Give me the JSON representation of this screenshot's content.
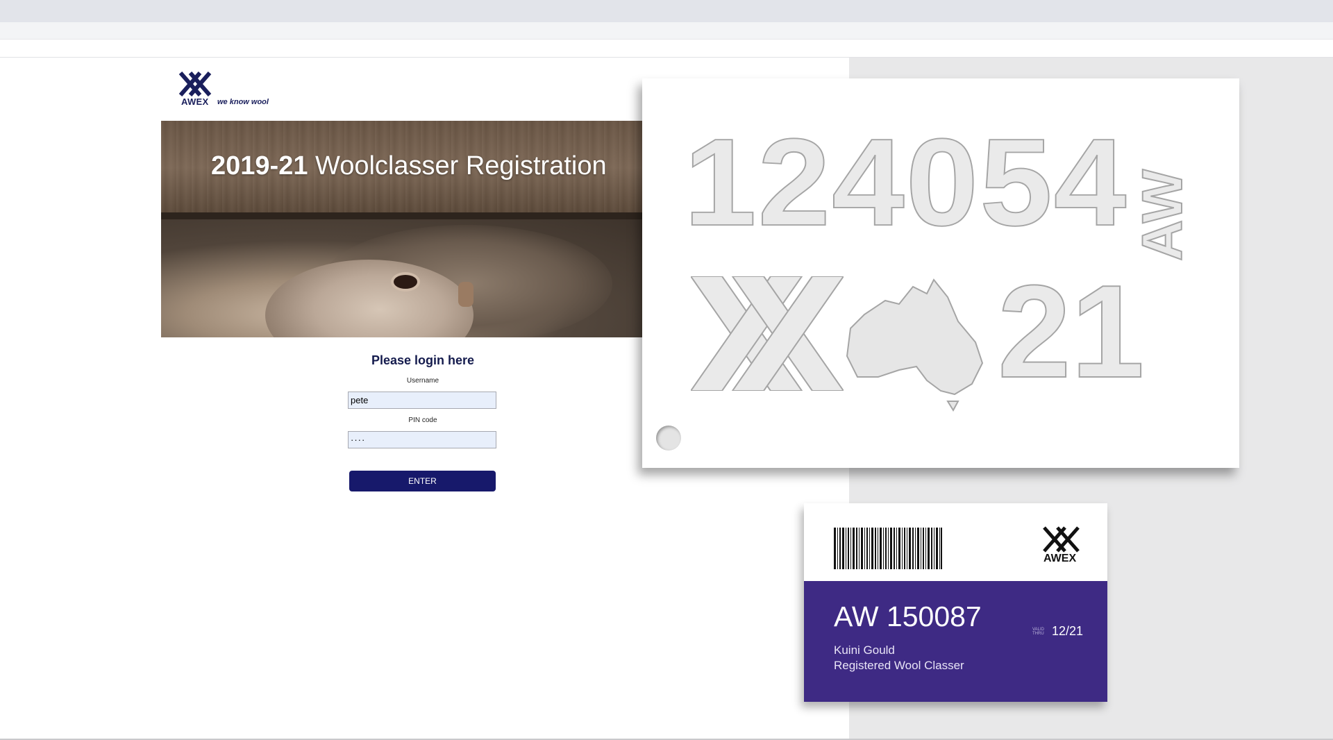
{
  "brand": {
    "name": "AWEX",
    "tagline": "we know wool",
    "navy": "#1a1f5c"
  },
  "hero": {
    "title_bold": "2019-21",
    "title_rest": " Woolclasser Registration"
  },
  "login": {
    "heading": "Please login here",
    "username_label": "Username",
    "username_value": "pete",
    "pin_label": "PIN code",
    "pin_value": "····",
    "enter_label": "ENTER"
  },
  "stencil": {
    "number": "124054",
    "code": "AW",
    "year": "21"
  },
  "card": {
    "brand": "AWEX",
    "id": "AW 150087",
    "valid_label_1": "VALID",
    "valid_label_2": "THRU",
    "valid": "12/21",
    "name": "Kuini Gould",
    "role": "Registered Wool Classer",
    "accent": "#3e2a84"
  },
  "colors": {
    "button": "#17196b",
    "panel": "#e8e8e9"
  }
}
